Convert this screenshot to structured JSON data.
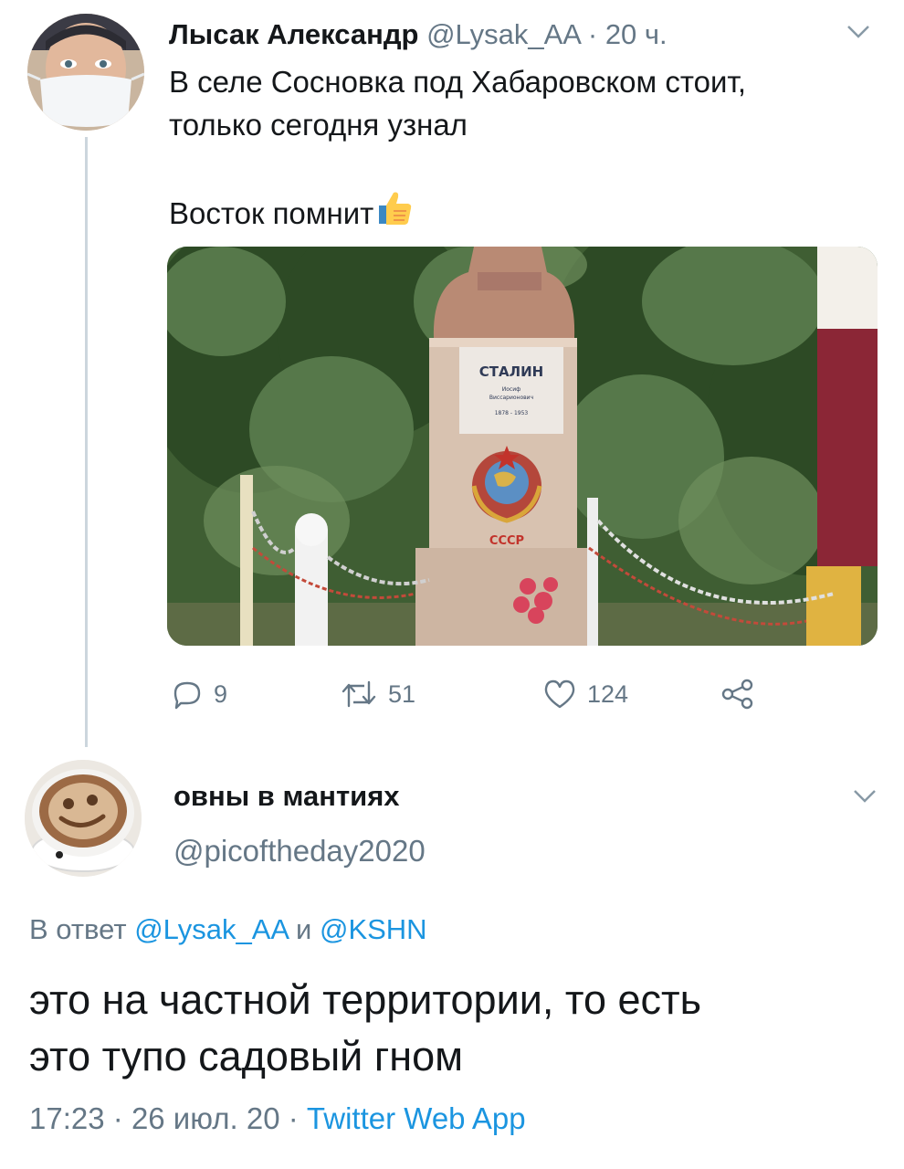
{
  "tweet": {
    "author_name": "Лысак Александр",
    "author_handle": "@Lysak_AA",
    "separator": " · ",
    "time_ago": "20 ч.",
    "text_line1": "В селе Сосновка под Хабаровском стоит,",
    "text_line2": "только сегодня узнал",
    "text_line3": "Восток помнит",
    "emoji": "thumbs-up-emoji",
    "photo": {
      "plaque_name": "СТАЛИН",
      "plaque_first": "Иосиф",
      "plaque_patronymic": "Виссарионович",
      "plaque_years": "1878 - 1953",
      "emblem_text": "СССР"
    },
    "actions": {
      "replies": "9",
      "retweets": "51",
      "likes": "124"
    }
  },
  "reply": {
    "author_name": "овны в мантиях",
    "author_handle": "@picoftheday2020",
    "reply_prefix": "В ответ",
    "reply_user1": "@Lysak_AA",
    "reply_and": "и",
    "reply_user2": "@KSHN",
    "text_line1": "это на частной территории, то есть",
    "text_line2": "это тупо садовый гном",
    "time": "17:23",
    "date": "26 июл. 20",
    "source": "Twitter Web App"
  },
  "colors": {
    "text": "#14171a",
    "secondary": "#657786",
    "link": "#1b95e0",
    "thread_line": "#ccd6dd"
  }
}
